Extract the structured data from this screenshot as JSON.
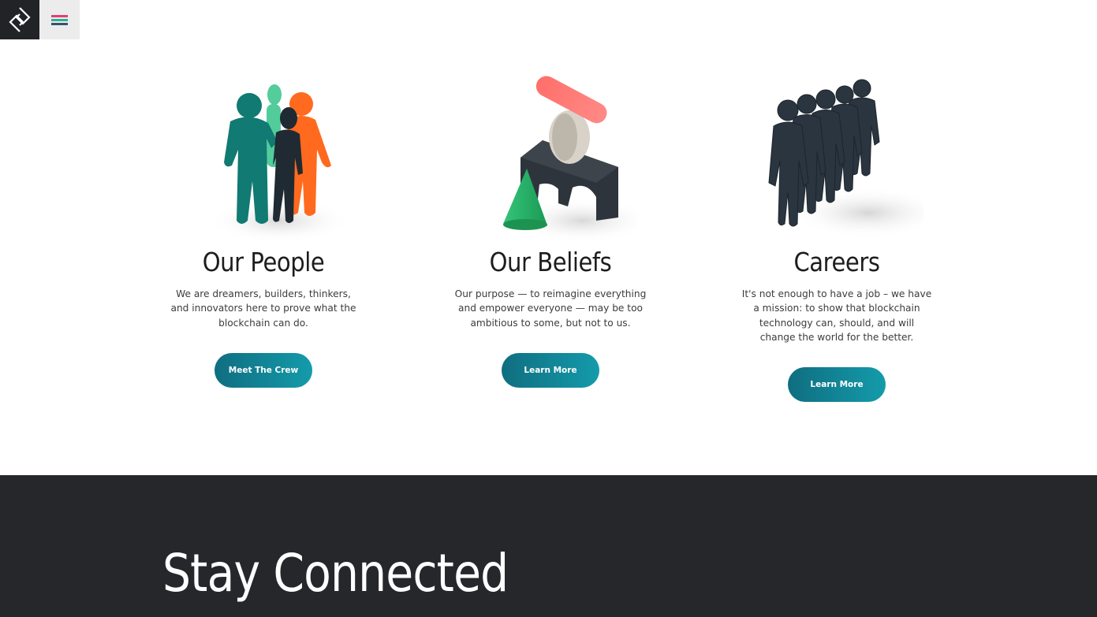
{
  "header": {
    "logo_icon": "diamond-s-logo-icon",
    "menu_icon": "hamburger-menu-icon",
    "menu_colors": [
      "#e23f7a",
      "#2fb093",
      "#33556e"
    ]
  },
  "cards": [
    {
      "title": "Our People",
      "text": "We are dreamers, builders, thinkers, and innovators here to prove what the blockchain can do.",
      "button": "Meet The Crew",
      "image_icon": "people-group-illustration"
    },
    {
      "title": "Our Beliefs",
      "text": "Our purpose — to reimagine everything and empower everyone — may be too ambitious to some, but not to us.",
      "button": "Learn More",
      "image_icon": "balanced-shapes-illustration"
    },
    {
      "title": "Careers",
      "text": "It's not enough to have a job – we have a mission: to show that blockchain technology can, should, and will change the world for the better.",
      "button": "Learn More",
      "image_icon": "people-line-illustration"
    }
  ],
  "footer": {
    "title": "Stay Connected"
  },
  "colors": {
    "accent": "#149bab",
    "dark": "#26272b"
  }
}
